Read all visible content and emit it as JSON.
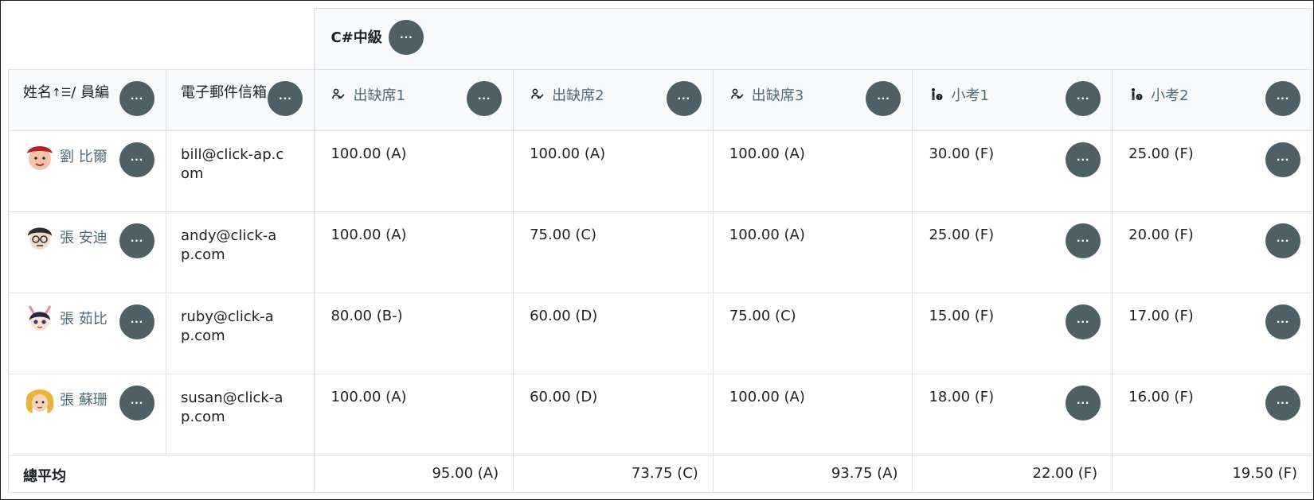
{
  "category": {
    "name": "C#中級"
  },
  "headers": {
    "name_label_a": "姓名",
    "name_label_b": "/ 員編",
    "email_label": "電子郵件信箱"
  },
  "items": [
    {
      "name": "出缺席1",
      "icon": "attendance-icon"
    },
    {
      "name": "出缺席2",
      "icon": "attendance-icon"
    },
    {
      "name": "出缺席3",
      "icon": "attendance-icon"
    },
    {
      "name": "小考1",
      "icon": "quiz-icon"
    },
    {
      "name": "小考2",
      "icon": "quiz-icon"
    }
  ],
  "students": [
    {
      "name": "劉 比爾",
      "email": "bill@click-ap.com",
      "grades": [
        "100.00 (A)",
        "100.00 (A)",
        "100.00 (A)",
        "30.00 (F)",
        "25.00 (F)"
      ]
    },
    {
      "name": "張 安迪",
      "email": "andy@click-ap.com",
      "grades": [
        "100.00 (A)",
        "75.00 (C)",
        "100.00 (A)",
        "25.00 (F)",
        "20.00 (F)"
      ]
    },
    {
      "name": "張 茹比",
      "email": "ruby@click-ap.com",
      "grades": [
        "80.00 (B-)",
        "60.00 (D)",
        "75.00 (C)",
        "15.00 (F)",
        "17.00 (F)"
      ]
    },
    {
      "name": "張 蘇珊",
      "email": "susan@click-ap.com",
      "grades": [
        "100.00 (A)",
        "60.00 (D)",
        "100.00 (A)",
        "18.00 (F)",
        "16.00 (F)"
      ]
    }
  ],
  "overall": {
    "label": "總平均",
    "averages": [
      "95.00 (A)",
      "73.75 (C)",
      "93.75 (A)",
      "22.00 (F)",
      "19.50 (F)"
    ]
  },
  "colors": {
    "menu_button": "#4f5f66",
    "link": "#4f6b7a",
    "header_bg": "#f8f9fa"
  }
}
